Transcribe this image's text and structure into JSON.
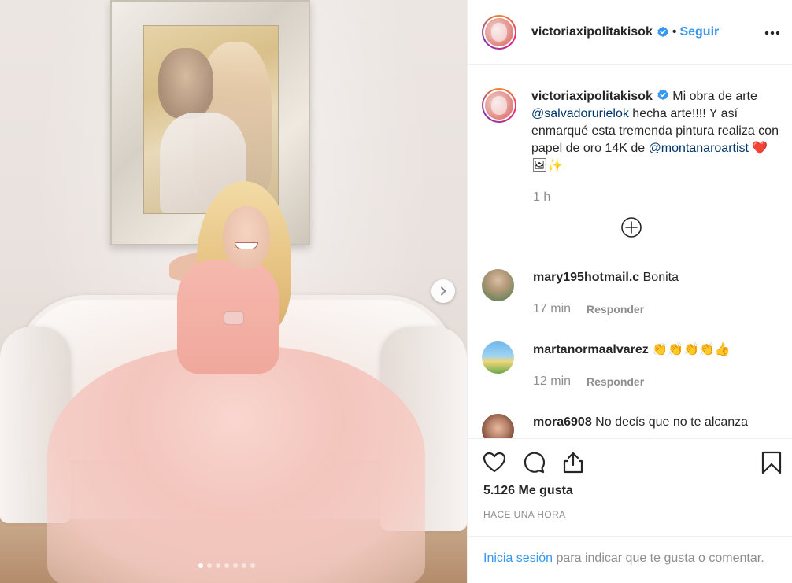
{
  "post": {
    "username": "victoriaxipolitakisok",
    "follow_label": "Seguir",
    "separator": "•"
  },
  "caption": {
    "username": "victoriaxipolitakisok",
    "text_1": " Mi obra de arte ",
    "mention_1": "@salvadorurielok",
    "text_2": " hecha arte!!!! Y así enmarqué esta tremenda pintura realiza con papel de oro 14K de ",
    "mention_2": "@montanaroartist",
    "emoji": " ❤️ 🖼✨",
    "time": "1 h"
  },
  "comments": [
    {
      "username": "mary195hotmail.c",
      "text": " Bonita",
      "time": "17 min",
      "reply": "Responder"
    },
    {
      "username": "martanormaalvarez",
      "text": " 👏👏👏👏👍",
      "time": "12 min",
      "reply": "Responder"
    },
    {
      "username": "mora6908",
      "text": " No decís que no te alcanza"
    }
  ],
  "actions": {
    "likes": "5.126 Me gusta",
    "timestamp": "HACE UNA HORA",
    "login_link": "Inicia sesión",
    "login_text": " para indicar que te gusta o comentar."
  },
  "carousel": {
    "slides": 7,
    "active_index": 0
  },
  "colors": {
    "link": "#3897f0",
    "mention": "#003569",
    "muted": "#8e8e8e",
    "text": "#262626"
  },
  "icons": [
    "verified-badge-icon",
    "more-options-icon",
    "load-more-icon",
    "heart-icon",
    "comment-icon",
    "share-icon",
    "bookmark-icon",
    "next-arrow-icon"
  ]
}
